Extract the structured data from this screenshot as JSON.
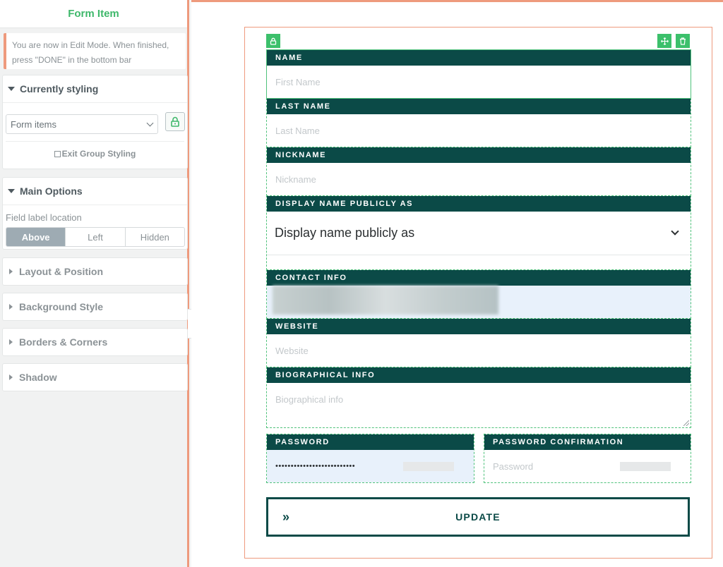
{
  "sidebar": {
    "title": "Form Item",
    "notice": "You are now in Edit Mode. When finished, press \"DONE\" in the bottom bar",
    "currently_styling": {
      "heading": "Currently styling",
      "selected": "Form items",
      "exit_label": "Exit Group Styling"
    },
    "main_options": {
      "heading": "Main Options",
      "field_label_location": "Field label location",
      "options": [
        "Above",
        "Left",
        "Hidden"
      ],
      "selected": "Above"
    },
    "sections": [
      "Layout & Position",
      "Background Style",
      "Borders & Corners",
      "Shadow"
    ]
  },
  "form": {
    "fields": [
      {
        "label": "NAME",
        "placeholder": "First Name"
      },
      {
        "label": "LAST NAME",
        "placeholder": "Last Name"
      },
      {
        "label": "NICKNAME",
        "placeholder": "Nickname"
      },
      {
        "label": "DISPLAY NAME PUBLICLY AS",
        "value": "Display name publicly as"
      },
      {
        "label": "CONTACT INFO"
      },
      {
        "label": "WEBSITE",
        "placeholder": "Website"
      },
      {
        "label": "BIOGRAPHICAL INFO",
        "placeholder": "Biographical info"
      }
    ],
    "password": {
      "label": "PASSWORD",
      "value": "••••••••••••••••••••••••••"
    },
    "password_confirmation": {
      "label": "PASSWORD CONFIRMATION",
      "placeholder": "Password"
    },
    "submit": {
      "label": "UPDATE",
      "icon": "»"
    }
  },
  "colors": {
    "accent": "#3fb86b",
    "label_bg": "#0b4a47",
    "edit_border": "#ee9a7d"
  }
}
